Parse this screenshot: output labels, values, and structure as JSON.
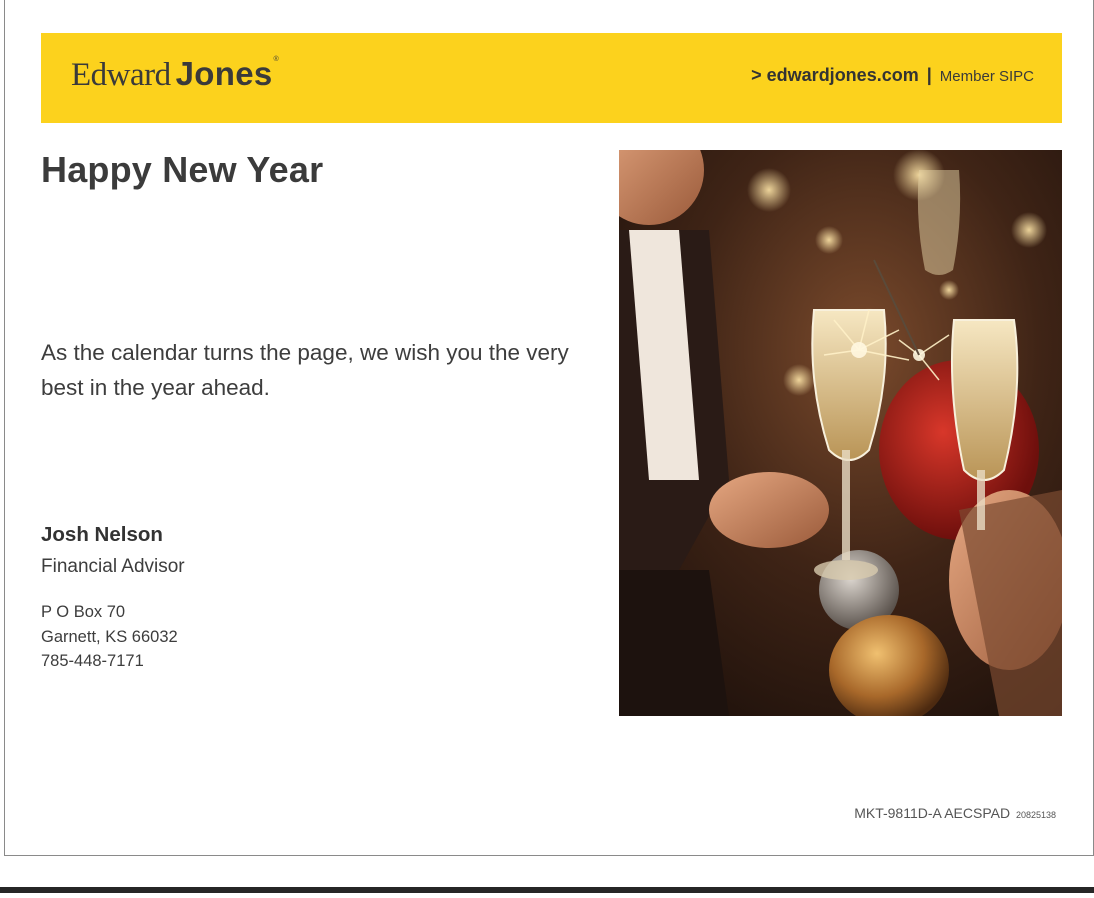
{
  "header": {
    "logo_edward": "Edward",
    "logo_jones": "Jones",
    "logo_reg": "®",
    "link_text": "> edwardjones.com",
    "separator": "|",
    "member_text": "Member SIPC"
  },
  "main": {
    "title": "Happy New Year",
    "message": "As the calendar turns the page, we wish you the very best in the year ahead."
  },
  "advisor": {
    "name": "Josh Nelson",
    "role": "Financial Advisor",
    "address_line1": "P O Box 70",
    "address_line2": "Garnett, KS 66032",
    "phone": "785-448-7171"
  },
  "footer": {
    "code": "MKT-9811D-A  AECSPAD",
    "code_small": "20825138"
  },
  "photo": {
    "description_icon": "champagne-toast-photo"
  },
  "colors": {
    "brand_yellow": "#fcd21d",
    "text_dark": "#3d3d3d"
  }
}
